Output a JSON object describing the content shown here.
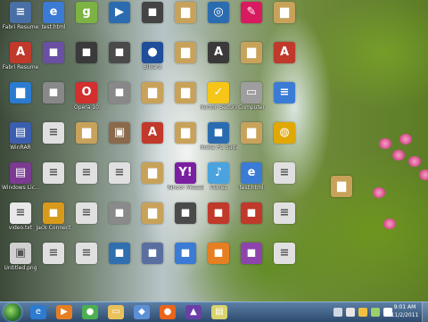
{
  "desktop": {
    "columns": [
      [
        {
          "label": "Fabri Resume",
          "icon": "document-icon",
          "color": "#4a6fa5"
        },
        {
          "label": "Fabri Resume",
          "icon": "pdf-icon",
          "color": "#c0392b"
        },
        {
          "label": "",
          "icon": "folder-icon",
          "color": "#2b7bd1"
        },
        {
          "label": "WinRAR",
          "icon": "winrar-icon",
          "color": "#3b5fae"
        },
        {
          "label": "Windows Lic...",
          "icon": "winrar-icon",
          "color": "#7a3b91"
        },
        {
          "label": "video.txt",
          "icon": "text-file-icon",
          "color": "#e8e8e8"
        },
        {
          "label": "Untitled.png",
          "icon": "image-file-icon",
          "color": "#d0d0d0"
        }
      ],
      [
        {
          "label": "test.html",
          "icon": "html-file-icon",
          "color": "#3a7bd5"
        },
        {
          "label": "",
          "icon": "app-icon",
          "color": "#6a4fa5"
        },
        {
          "label": "",
          "icon": "app-icon",
          "color": "#888888"
        },
        {
          "label": "",
          "icon": "document-icon",
          "color": "#e0e0e0"
        },
        {
          "label": "",
          "icon": "document-icon",
          "color": "#e0e0e0"
        },
        {
          "label": "Jack Connect",
          "icon": "app-icon",
          "color": "#d89a1a"
        },
        {
          "label": "",
          "icon": "document-icon",
          "color": "#e0e0e0"
        }
      ],
      [
        {
          "label": "",
          "icon": "game-icon",
          "color": "#7cb342"
        },
        {
          "label": "",
          "icon": "app-icon",
          "color": "#3a3a3a"
        },
        {
          "label": "Opera 10",
          "icon": "opera-icon",
          "color": "#d32f2f"
        },
        {
          "label": "",
          "icon": "folder-icon",
          "color": "#c8a25a"
        },
        {
          "label": "",
          "icon": "document-icon",
          "color": "#e0e0e0"
        },
        {
          "label": "",
          "icon": "document-icon",
          "color": "#e0e0e0"
        },
        {
          "label": "",
          "icon": "document-icon",
          "color": "#e0e0e0"
        }
      ],
      [
        {
          "label": "",
          "icon": "media-player-icon",
          "color": "#2b6cb0"
        },
        {
          "label": "",
          "icon": "app-icon",
          "color": "#4a4a4a"
        },
        {
          "label": "",
          "icon": "app-icon",
          "color": "#888888"
        },
        {
          "label": "",
          "icon": "image-file-icon",
          "color": "#8a6a4a"
        },
        {
          "label": "",
          "icon": "document-icon",
          "color": "#e0e0e0"
        },
        {
          "label": "",
          "icon": "app-icon",
          "color": "#8a8a8a"
        },
        {
          "label": "",
          "icon": "app-icon",
          "color": "#2f6fb0"
        }
      ],
      [
        {
          "label": "",
          "icon": "app-icon",
          "color": "#444444"
        },
        {
          "label": "Billiard",
          "icon": "billiard-icon",
          "color": "#1f4e9a"
        },
        {
          "label": "",
          "icon": "folder-icon",
          "color": "#c8a25a"
        },
        {
          "label": "",
          "icon": "pdf-icon",
          "color": "#c0392b"
        },
        {
          "label": "",
          "icon": "folder-icon",
          "color": "#c8a25a"
        },
        {
          "label": "",
          "icon": "folder-icon",
          "color": "#c8a25a"
        },
        {
          "label": "",
          "icon": "app-icon",
          "color": "#5a6fa0"
        }
      ],
      [
        {
          "label": "",
          "icon": "folder-icon",
          "color": "#c8a25a"
        },
        {
          "label": "",
          "icon": "folder-icon",
          "color": "#c8a25a"
        },
        {
          "label": "",
          "icon": "folder-icon",
          "color": "#c8a25a"
        },
        {
          "label": "",
          "icon": "folder-icon",
          "color": "#c8a25a"
        },
        {
          "label": "Yahoo! Messenger",
          "icon": "yahoo-icon",
          "color": "#7b1fa2"
        },
        {
          "label": "",
          "icon": "app-icon",
          "color": "#4a4a4a"
        },
        {
          "label": "",
          "icon": "app-icon",
          "color": "#3a7bd5"
        }
      ],
      [
        {
          "label": "",
          "icon": "network-icon",
          "color": "#2b6cb0"
        },
        {
          "label": "",
          "icon": "ajax-icon",
          "color": "#3a3a3a"
        },
        {
          "label": "Norton Security Scan",
          "icon": "norton-icon",
          "color": "#f5c518"
        },
        {
          "label": "Nokia PC Suite",
          "icon": "app-icon",
          "color": "#2b6cb0"
        },
        {
          "label": "iTunes",
          "icon": "itunes-icon",
          "color": "#4aa3df"
        },
        {
          "label": "",
          "icon": "app-icon",
          "color": "#c0392b"
        },
        {
          "label": "",
          "icon": "app-icon",
          "color": "#e67e22"
        }
      ],
      [
        {
          "label": "",
          "icon": "paint-icon",
          "color": "#d81b60"
        },
        {
          "label": "",
          "icon": "folder-icon",
          "color": "#c8a25a"
        },
        {
          "label": "Computer",
          "icon": "computer-icon",
          "color": "#9e9e9e"
        },
        {
          "label": "",
          "icon": "folder-icon",
          "color": "#c8a25a"
        },
        {
          "label": "test.html",
          "icon": "html-file-icon",
          "color": "#3a7bd5"
        },
        {
          "label": "",
          "icon": "app-icon",
          "color": "#c0392b"
        },
        {
          "label": "",
          "icon": "app-icon",
          "color": "#8e44ad"
        }
      ],
      [
        {
          "label": "",
          "icon": "folder-icon",
          "color": "#c8a25a"
        },
        {
          "label": "",
          "icon": "pdf-icon",
          "color": "#c0392b"
        },
        {
          "label": "",
          "icon": "document-icon",
          "color": "#3a7bd5"
        },
        {
          "label": "",
          "icon": "globe-icon",
          "color": "#e0a800"
        },
        {
          "label": "",
          "icon": "document-icon",
          "color": "#e0e0e0"
        },
        {
          "label": "",
          "icon": "document-icon",
          "color": "#e0e0e0"
        },
        {
          "label": "",
          "icon": "document-icon",
          "color": "#e0e0e0"
        }
      ]
    ],
    "extra_icons": [
      {
        "label": "",
        "icon": "folder-icon",
        "color": "#c8a25a"
      }
    ],
    "flower_color": "#d44a8b"
  },
  "taskbar": {
    "pinned": [
      {
        "icon": "ie-icon",
        "color": "#2b7bd1",
        "glyph": "e"
      },
      {
        "icon": "media-player-icon",
        "color": "#e67e22",
        "glyph": "▶"
      },
      {
        "icon": "chrome-icon",
        "color": "#4caf50",
        "glyph": "●"
      },
      {
        "icon": "explorer-icon",
        "color": "#e8c15a",
        "glyph": "▭"
      },
      {
        "icon": "virtualbox-icon",
        "color": "#5c8fd6",
        "glyph": "◆"
      },
      {
        "icon": "firefox-icon",
        "color": "#e8651a",
        "glyph": "●"
      },
      {
        "icon": "visual-studio-icon",
        "color": "#6a3fa5",
        "glyph": "▲"
      },
      {
        "icon": "notes-icon",
        "color": "#d9d36b",
        "glyph": "▤"
      }
    ],
    "clock_time": "9:01 AM",
    "clock_date": "11/2/2011"
  }
}
